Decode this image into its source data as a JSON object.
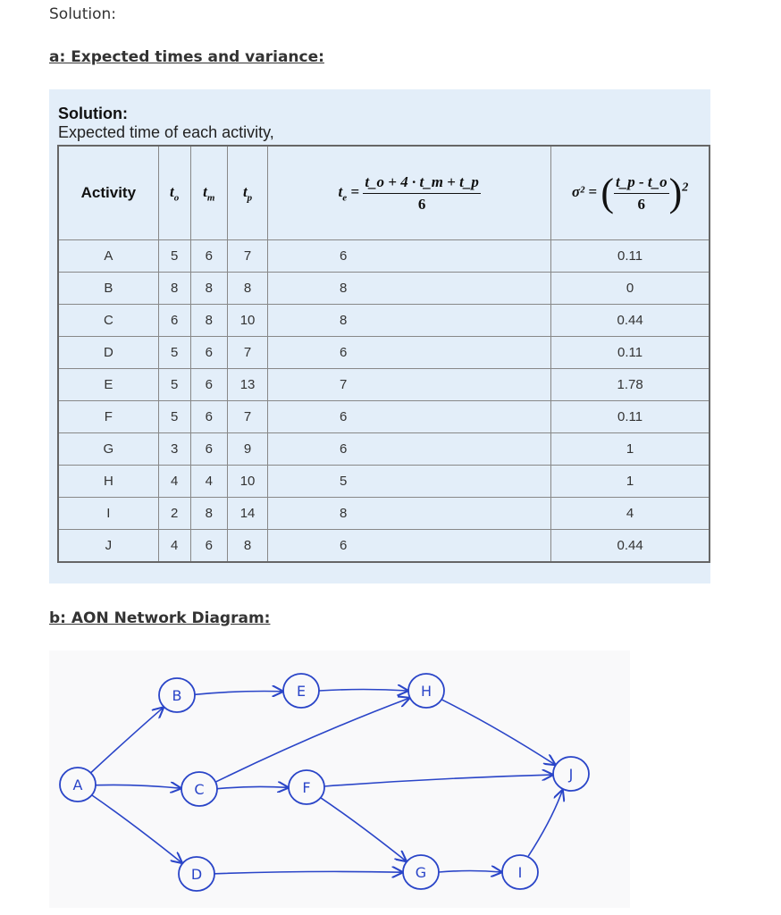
{
  "intro": "Solution:",
  "section_a": {
    "heading": "a: Expected times and variance:"
  },
  "solution_box": {
    "title": "Solution:",
    "subtitle": "Expected time of each activity,",
    "headers": {
      "activity": "Activity",
      "to": "t",
      "to_sub": "o",
      "tm": "t",
      "tm_sub": "m",
      "tp": "t",
      "tp_sub": "p",
      "te_formula": {
        "lhs": "t",
        "lhs_sub": "e",
        "numerator": "t_o + 4 · t_m + t_p",
        "denominator": "6"
      },
      "variance_formula": {
        "lhs": "σ²",
        "numerator": "t_p - t_o",
        "denominator": "6",
        "exponent": "2"
      }
    },
    "rows": [
      {
        "activity": "A",
        "to": "5",
        "tm": "6",
        "tp": "7",
        "te": "6",
        "variance": "0.11"
      },
      {
        "activity": "B",
        "to": "8",
        "tm": "8",
        "tp": "8",
        "te": "8",
        "variance": "0"
      },
      {
        "activity": "C",
        "to": "6",
        "tm": "8",
        "tp": "10",
        "te": "8",
        "variance": "0.44"
      },
      {
        "activity": "D",
        "to": "5",
        "tm": "6",
        "tp": "7",
        "te": "6",
        "variance": "0.11"
      },
      {
        "activity": "E",
        "to": "5",
        "tm": "6",
        "tp": "13",
        "te": "7",
        "variance": "1.78"
      },
      {
        "activity": "F",
        "to": "5",
        "tm": "6",
        "tp": "7",
        "te": "6",
        "variance": "0.11"
      },
      {
        "activity": "G",
        "to": "3",
        "tm": "6",
        "tp": "9",
        "te": "6",
        "variance": "1"
      },
      {
        "activity": "H",
        "to": "4",
        "tm": "4",
        "tp": "10",
        "te": "5",
        "variance": "1"
      },
      {
        "activity": "I",
        "to": "2",
        "tm": "8",
        "tp": "14",
        "te": "8",
        "variance": "4"
      },
      {
        "activity": "J",
        "to": "4",
        "tm": "6",
        "tp": "8",
        "te": "6",
        "variance": "0.44"
      }
    ]
  },
  "section_b": {
    "heading": "b: AON Network Diagram:"
  },
  "network": {
    "stroke_color": "#2a45c8",
    "background": "#f9f9fa",
    "nodes": [
      {
        "id": "A",
        "label": "A"
      },
      {
        "id": "B",
        "label": "B"
      },
      {
        "id": "C",
        "label": "C"
      },
      {
        "id": "D",
        "label": "D"
      },
      {
        "id": "E",
        "label": "E"
      },
      {
        "id": "F",
        "label": "F"
      },
      {
        "id": "G",
        "label": "G"
      },
      {
        "id": "H",
        "label": "H"
      },
      {
        "id": "I",
        "label": "I"
      },
      {
        "id": "J",
        "label": "J"
      }
    ],
    "edges": [
      [
        "A",
        "B"
      ],
      [
        "A",
        "C"
      ],
      [
        "A",
        "D"
      ],
      [
        "B",
        "E"
      ],
      [
        "C",
        "F"
      ],
      [
        "C",
        "H"
      ],
      [
        "E",
        "H"
      ],
      [
        "D",
        "G"
      ],
      [
        "F",
        "G"
      ],
      [
        "F",
        "J"
      ],
      [
        "G",
        "I"
      ],
      [
        "H",
        "J"
      ],
      [
        "I",
        "J"
      ]
    ]
  }
}
